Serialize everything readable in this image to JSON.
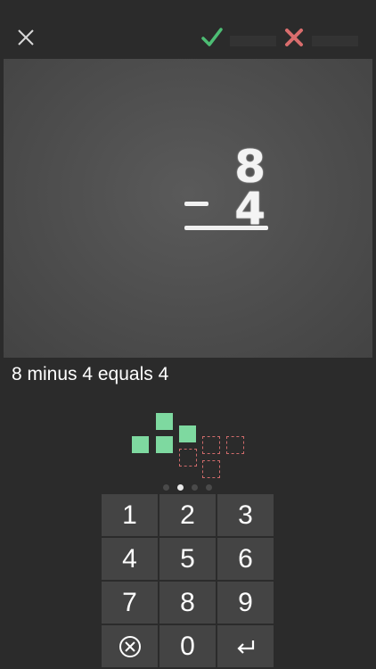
{
  "topbar": {
    "close_icon": "close-icon",
    "correct_icon": "checkmark-icon",
    "wrong_icon": "cross-icon",
    "correct_color": "#4dbd74",
    "wrong_color": "#d96d6d"
  },
  "problem": {
    "top_operand": "8",
    "bottom_operand": "4",
    "operator": "minus"
  },
  "caption": "8 minus 4 equals 4",
  "progress": {
    "pages": 4,
    "active_index": 1
  },
  "keypad": {
    "k1": "1",
    "k2": "2",
    "k3": "3",
    "k4": "4",
    "k5": "5",
    "k6": "6",
    "k7": "7",
    "k8": "8",
    "k9": "9",
    "clear_icon": "clear-circle-icon",
    "k0": "0",
    "enter_icon": "return-icon"
  },
  "colors": {
    "background": "#2b2b2b",
    "chalkboard": "#4c4c4c",
    "block_fill": "#7ed9a0",
    "block_outline": "#cf6b6b",
    "key": "#444444"
  }
}
